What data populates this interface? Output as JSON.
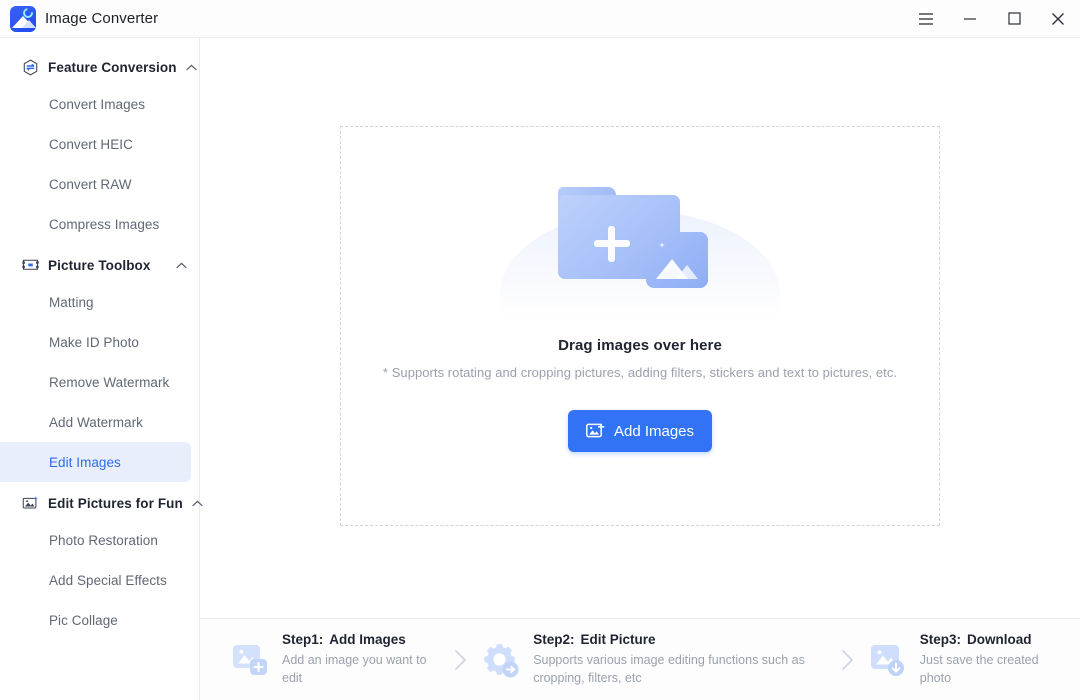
{
  "window": {
    "app_title": "Image Converter",
    "logo_icon": "image-converter-logo-icon",
    "controls": {
      "menu_label": "menu-icon",
      "minimize_label": "minimize-icon",
      "maximize_label": "maximize-icon",
      "close_label": "close-icon"
    }
  },
  "sidebar": {
    "groups": [
      {
        "label": "Feature Conversion",
        "icon": "convert-hexagon-icon",
        "expanded": true,
        "caret": "chevron-up-icon",
        "items": [
          {
            "label": "Convert Images",
            "active": false
          },
          {
            "label": "Convert HEIC",
            "active": false
          },
          {
            "label": "Convert RAW",
            "active": false
          },
          {
            "label": "Compress Images",
            "active": false
          }
        ]
      },
      {
        "label": "Picture Toolbox",
        "icon": "crop-frame-icon",
        "expanded": true,
        "caret": "chevron-up-icon",
        "items": [
          {
            "label": "Matting",
            "active": false
          },
          {
            "label": "Make ID Photo",
            "active": false
          },
          {
            "label": "Remove Watermark",
            "active": false
          },
          {
            "label": "Add Watermark",
            "active": false
          },
          {
            "label": "Edit Images",
            "active": true
          }
        ]
      },
      {
        "label": "Edit Pictures for Fun",
        "icon": "photo-sparkle-icon",
        "expanded": true,
        "caret": "chevron-up-icon",
        "items": [
          {
            "label": "Photo Restoration",
            "active": false
          },
          {
            "label": "Add Special Effects",
            "active": false
          },
          {
            "label": "Pic Collage",
            "active": false
          }
        ]
      }
    ]
  },
  "dropzone": {
    "illustration": "folder-add-image-illustration",
    "title": "Drag images over here",
    "subtitle": "* Supports rotating and cropping pictures, adding filters, stickers and text to pictures, etc.",
    "button_label": "Add Images",
    "button_icon": "add-image-icon"
  },
  "steps": [
    {
      "icon": "add-photo-icon",
      "number": "Step1:",
      "title": "Add Images",
      "desc": "Add an image you want to edit"
    },
    {
      "icon": "gear-arrow-icon",
      "number": "Step2:",
      "title": "Edit Picture",
      "desc": "Supports various image editing functions such as cropping, filters, etc"
    },
    {
      "icon": "download-photo-icon",
      "number": "Step3:",
      "title": "Download",
      "desc": "Just save the created photo"
    }
  ],
  "separator_icon": "chevron-right-icon",
  "colors": {
    "accent": "#3273f5",
    "active_item_bg": "#e8eefc",
    "active_item_text": "#2f6bed",
    "muted_text": "#9aa1ad"
  }
}
